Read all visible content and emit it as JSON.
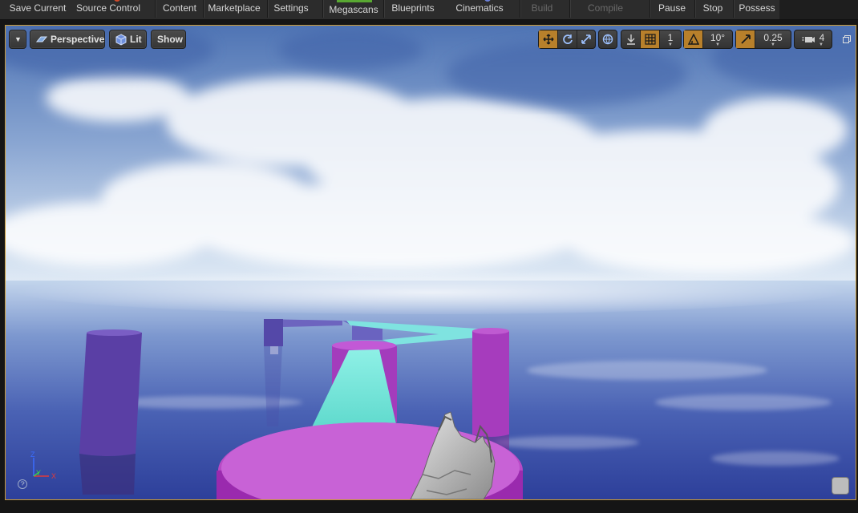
{
  "toolbar": {
    "save_current": "Save Current",
    "source_control": "Source Control",
    "content": "Content",
    "marketplace": "Marketplace",
    "settings": "Settings",
    "megascans": "Megascans",
    "blueprints": "Blueprints",
    "cinematics": "Cinematics",
    "build": "Build",
    "compile": "Compile",
    "pause": "Pause",
    "stop": "Stop",
    "possess": "Possess"
  },
  "viewport": {
    "view_mode": "Perspective",
    "lighting_mode": "Lit",
    "show_label": "Show",
    "grid_snap_value": "1",
    "rotation_snap_value": "10°",
    "scale_snap_value": "0.25",
    "camera_speed_value": "4",
    "axis_labels": {
      "z": "Z",
      "y": "Y",
      "x": "X"
    }
  },
  "colors": {
    "active_tab": "#59a832",
    "snap_on": "#b8802b",
    "viewport_border": "#c99a36",
    "platform_magenta": "#b03fbf",
    "pillar_purple": "#6b3aa8",
    "ramp_cyan": "#6fe0d4"
  }
}
